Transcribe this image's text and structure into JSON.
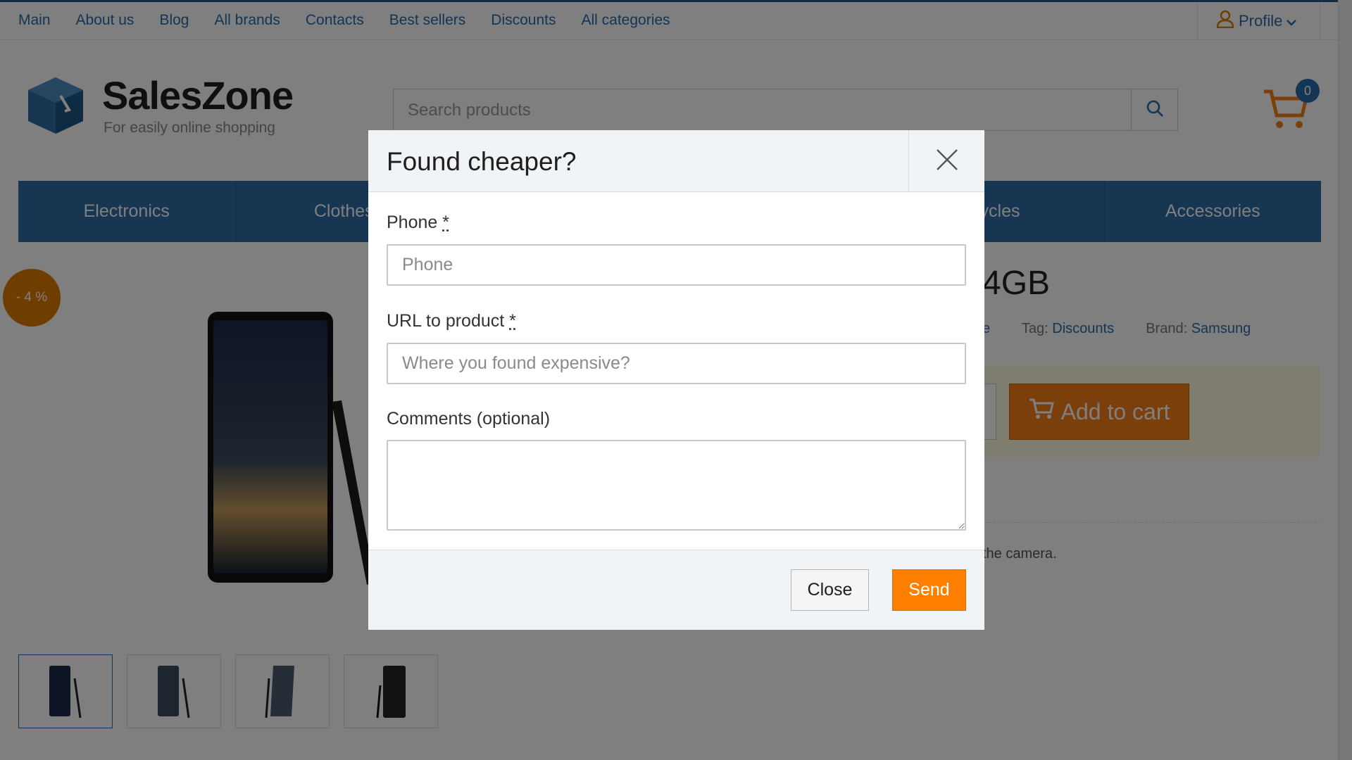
{
  "topnav": {
    "links": [
      "Main",
      "About us",
      "Blog",
      "All brands",
      "Contacts",
      "Best sellers",
      "Discounts",
      "All categories"
    ],
    "profile": "Profile"
  },
  "header": {
    "brand": "SalesZone",
    "tagline": "For easily online shopping",
    "search_placeholder": "Search products",
    "cart_count": "0"
  },
  "categories": [
    "Electronics",
    "Clothes",
    "",
    "",
    "cycles",
    "Accessories"
  ],
  "product": {
    "discount_badge": "- 4 %",
    "title_visible": "4GB",
    "tag_label": "Tag:",
    "tag_value": "Discounts",
    "brand_label": "Brand:",
    "brand_value": "Samsung",
    "meta_prefix": "e",
    "add_to_cart": "Add to cart",
    "desc_fragment": "the camera."
  },
  "modal": {
    "title": "Found cheaper?",
    "phone_label": "Phone",
    "phone_placeholder": "Phone",
    "url_label": "URL to product",
    "url_placeholder": "Where you found expensive?",
    "comments_label": "Comments (optional)",
    "required_mark": "*",
    "close_button": "Close",
    "send_button": "Send"
  },
  "colors": {
    "accent_blue": "#2e6da4",
    "accent_orange": "#ff7f00"
  }
}
